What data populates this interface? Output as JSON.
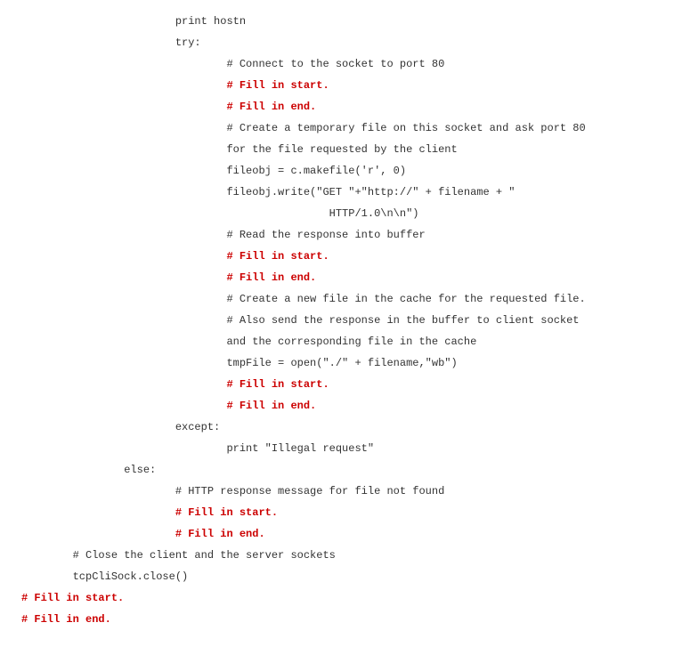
{
  "code": {
    "l01": "print hostn",
    "l02": "try:",
    "l03": "# Connect to the socket to port 80",
    "l04": "# Fill in start.",
    "l05": "# Fill in end.",
    "l06": "# Create a temporary file on this socket and ask port 80",
    "l07": "for the file requested by the client",
    "l08": "fileobj = c.makefile('r', 0)",
    "l09": "fileobj.write(\"GET \"+\"http://\" + filename + \"",
    "l10": "HTTP/1.0\\n\\n\")",
    "l11": "# Read the response into buffer",
    "l12": "# Fill in start.",
    "l13": "# Fill in end.",
    "l14": "# Create a new file in the cache for the requested file.",
    "l15": "# Also send the response in the buffer to client socket",
    "l16": "and the corresponding file in the cache",
    "l17": "tmpFile = open(\"./\" + filename,\"wb\")",
    "l18": "# Fill in start.",
    "l19": "# Fill in end.",
    "l20": "except:",
    "l21": "print \"Illegal request\"",
    "l22": "else:",
    "l23": "# HTTP response message for file not found",
    "l24": "# Fill in start.",
    "l25": "# Fill in end.",
    "l26": "# Close the client and the server sockets",
    "l27": "tcpCliSock.close()",
    "l28": "# Fill in start.",
    "l29": "# Fill in end."
  }
}
